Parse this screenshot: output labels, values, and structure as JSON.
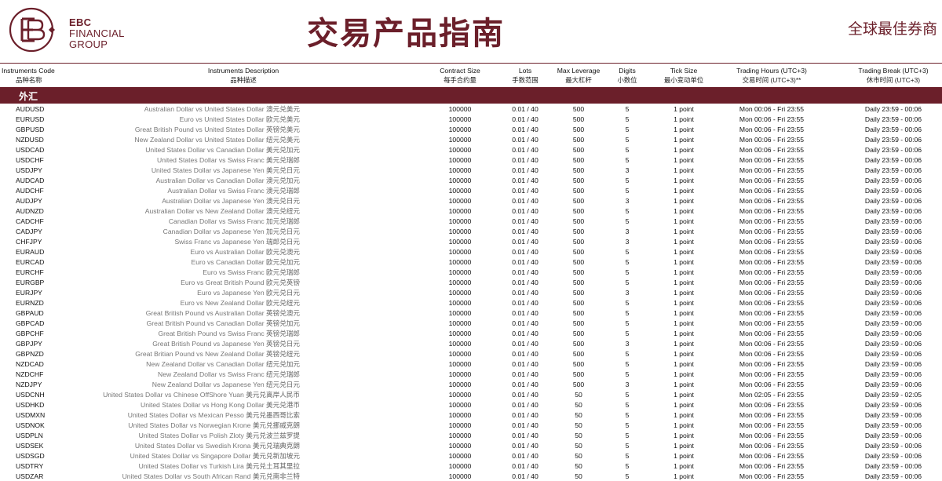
{
  "header": {
    "logo": {
      "line1": "EBC",
      "line2": "FINANCIAL",
      "line3": "GROUP"
    },
    "title": "交易产品指南",
    "slogan": "全球最佳券商"
  },
  "colors": {
    "brand": "#6b1f2a"
  },
  "columns": [
    {
      "en": "Instruments Code",
      "cn": "品种名称"
    },
    {
      "en": "Instruments Description",
      "cn": "品种描述"
    },
    {
      "en": "Contract Size",
      "cn": "每手合约量"
    },
    {
      "en": "Lots",
      "cn": "手数范围"
    },
    {
      "en": "Max Leverage",
      "cn": "最大杠杆"
    },
    {
      "en": "Digits",
      "cn": "小数位"
    },
    {
      "en": "Tick Size",
      "cn": "最小变动单位"
    },
    {
      "en": "Trading Hours (UTC+3)",
      "cn": "交易时间 (UTC+3)**"
    },
    {
      "en": "Trading Break  (UTC+3)",
      "cn": "休市时间 (UTC+3)"
    }
  ],
  "section": {
    "label": "外汇"
  },
  "rows": [
    [
      "AUDUSD",
      "Australian Dollar vs United States Dollar",
      "澳元兑美元",
      "100000",
      "0.01 / 40",
      "500",
      "5",
      "1 point",
      "Mon 00:06 - Fri 23:55",
      "Daily 23:59 - 00:06"
    ],
    [
      "EURUSD",
      "Euro vs United States Dollar",
      "欧元兑美元",
      "100000",
      "0.01 / 40",
      "500",
      "5",
      "1 point",
      "Mon 00:06 - Fri 23:55",
      "Daily 23:59 - 00:06"
    ],
    [
      "GBPUSD",
      "Great British Pound vs United States Dollar",
      "英镑兑美元",
      "100000",
      "0.01 / 40",
      "500",
      "5",
      "1 point",
      "Mon 00:06 - Fri 23:55",
      "Daily 23:59 - 00:06"
    ],
    [
      "NZDUSD",
      "New Zealand Dollar vs United States Dollar",
      "纽元兑美元",
      "100000",
      "0.01 / 40",
      "500",
      "5",
      "1 point",
      "Mon 00:06 - Fri 23:55",
      "Daily 23:59 - 00:06"
    ],
    [
      "USDCAD",
      "United States Dollar vs Canadian Dollar",
      "美元兑加元",
      "100000",
      "0.01 / 40",
      "500",
      "5",
      "1 point",
      "Mon 00:06 - Fri 23:55",
      "Daily 23:59 - 00:06"
    ],
    [
      "USDCHF",
      "United States Dollar vs Swiss Franc",
      "美元兑瑞郎",
      "100000",
      "0.01 / 40",
      "500",
      "5",
      "1 point",
      "Mon 00:06 - Fri 23:55",
      "Daily 23:59 - 00:06"
    ],
    [
      "USDJPY",
      "United States Dollar vs Japanese Yen",
      "美元兑日元",
      "100000",
      "0.01 / 40",
      "500",
      "3",
      "1 point",
      "Mon 00:06 - Fri 23:55",
      "Daily 23:59 - 00:06"
    ],
    [
      "AUDCAD",
      "Australian Dollar vs Canadian Dollar",
      "澳元兑加元",
      "100000",
      "0.01 / 40",
      "500",
      "5",
      "1 point",
      "Mon 00:06 - Fri 23:55",
      "Daily 23:59 - 00:06"
    ],
    [
      "AUDCHF",
      "Australian Dollar vs Swiss Franc",
      "澳元兑瑞郎",
      "100000",
      "0.01 / 40",
      "500",
      "5",
      "1 point",
      "Mon 00:06 - Fri 23:55",
      "Daily 23:59 - 00:06"
    ],
    [
      "AUDJPY",
      "Australian Dollar vs Japanese Yen",
      "澳元兑日元",
      "100000",
      "0.01 / 40",
      "500",
      "3",
      "1 point",
      "Mon 00:06 - Fri 23:55",
      "Daily 23:59 - 00:06"
    ],
    [
      "AUDNZD",
      "Australian Dollar vs New Zealand Dollar",
      "澳元兑纽元",
      "100000",
      "0.01 / 40",
      "500",
      "5",
      "1 point",
      "Mon 00:06 - Fri 23:55",
      "Daily 23:59 - 00:06"
    ],
    [
      "CADCHF",
      "Canadian Dollar vs Swiss Franc",
      "加元兑瑞郎",
      "100000",
      "0.01 / 40",
      "500",
      "5",
      "1 point",
      "Mon 00:06 - Fri 23:55",
      "Daily 23:59 - 00:06"
    ],
    [
      "CADJPY",
      "Canadian Dollar vs Japanese Yen",
      "加元兑日元",
      "100000",
      "0.01 / 40",
      "500",
      "3",
      "1 point",
      "Mon 00:06 - Fri 23:55",
      "Daily 23:59 - 00:06"
    ],
    [
      "CHFJPY",
      "Swiss Franc vs Japanese Yen",
      "瑞郎兑日元",
      "100000",
      "0.01 / 40",
      "500",
      "3",
      "1 point",
      "Mon 00:06 - Fri 23:55",
      "Daily 23:59 - 00:06"
    ],
    [
      "EURAUD",
      "Euro vs Australian Dollar",
      "欧元兑澳元",
      "100000",
      "0.01 / 40",
      "500",
      "5",
      "1 point",
      "Mon 00:06 - Fri 23:55",
      "Daily 23:59 - 00:06"
    ],
    [
      "EURCAD",
      "Euro vs Canadian Dollar",
      "欧元兑加元",
      "100000",
      "0.01 / 40",
      "500",
      "5",
      "1 point",
      "Mon 00:06 - Fri 23:55",
      "Daily 23:59 - 00:06"
    ],
    [
      "EURCHF",
      "Euro vs Swiss Franc",
      "欧元兑瑞郎",
      "100000",
      "0.01 / 40",
      "500",
      "5",
      "1 point",
      "Mon 00:06 - Fri 23:55",
      "Daily 23:59 - 00:06"
    ],
    [
      "EURGBP",
      "Euro vs Great British Pound",
      "欧元兑英镑",
      "100000",
      "0.01 / 40",
      "500",
      "5",
      "1 point",
      "Mon 00:06 - Fri 23:55",
      "Daily 23:59 - 00:06"
    ],
    [
      "EURJPY",
      "Euro vs Japanese Yen",
      "欧元兑日元",
      "100000",
      "0.01 / 40",
      "500",
      "3",
      "1 point",
      "Mon 00:06 - Fri 23:55",
      "Daily 23:59 - 00:06"
    ],
    [
      "EURNZD",
      "Euro vs New Zealand Dollar",
      "欧元兑纽元",
      "100000",
      "0.01 / 40",
      "500",
      "5",
      "1 point",
      "Mon 00:06 - Fri 23:55",
      "Daily 23:59 - 00:06"
    ],
    [
      "GBPAUD",
      "Great British Pound vs Australian Dollar",
      "英镑兑澳元",
      "100000",
      "0.01 / 40",
      "500",
      "5",
      "1 point",
      "Mon 00:06 - Fri 23:55",
      "Daily 23:59 - 00:06"
    ],
    [
      "GBPCAD",
      "Great British Pound vs Canadian Dollar",
      "英镑兑加元",
      "100000",
      "0.01 / 40",
      "500",
      "5",
      "1 point",
      "Mon 00:06 - Fri 23:55",
      "Daily 23:59 - 00:06"
    ],
    [
      "GBPCHF",
      "Great British Pound vs Swiss Franc",
      "英镑兑瑞郎",
      "100000",
      "0.01 / 40",
      "500",
      "5",
      "1 point",
      "Mon 00:06 - Fri 23:55",
      "Daily 23:59 - 00:06"
    ],
    [
      "GBPJPY",
      "Great British Pound vs Japanese Yen",
      "英镑兑日元",
      "100000",
      "0.01 / 40",
      "500",
      "3",
      "1 point",
      "Mon 00:06 - Fri 23:55",
      "Daily 23:59 - 00:06"
    ],
    [
      "GBPNZD",
      "Great Britian Pound vs New Zealand Dollar",
      "英镑兑纽元",
      "100000",
      "0.01 / 40",
      "500",
      "5",
      "1 point",
      "Mon 00:06 - Fri 23:55",
      "Daily 23:59 - 00:06"
    ],
    [
      "NZDCAD",
      "New Zealand Dollar vs Canadian Dollar",
      "纽元兑加元",
      "100000",
      "0.01 / 40",
      "500",
      "5",
      "1 point",
      "Mon 00:06 - Fri 23:55",
      "Daily 23:59 - 00:06"
    ],
    [
      "NZDCHF",
      "New Zealand Dollar vs Swiss Franc",
      "纽元兑瑞郎",
      "100000",
      "0.01 / 40",
      "500",
      "5",
      "1 point",
      "Mon 00:06 - Fri 23:55",
      "Daily 23:59 - 00:06"
    ],
    [
      "NZDJPY",
      "New Zealand Dollar vs Japanese Yen",
      "纽元兑日元",
      "100000",
      "0.01 / 40",
      "500",
      "3",
      "1 point",
      "Mon 00:06 - Fri 23:55",
      "Daily 23:59 - 00:06"
    ],
    [
      "USDCNH",
      "United States Dollar vs Chinese OffShore Yuan",
      "美元兑离岸人民币",
      "100000",
      "0.01 / 40",
      "50",
      "5",
      "1 point",
      "Mon 02:05 - Fri 23:55",
      "Daily 23:59 - 02:05"
    ],
    [
      "USDHKD",
      "United States Dollar vs Hong Kong Dollar",
      "美元兑港币",
      "100000",
      "0.01 / 40",
      "50",
      "5",
      "1 point",
      "Mon 00:06 - Fri 23:55",
      "Daily 23:59 - 00:06"
    ],
    [
      "USDMXN",
      "United States Dollar vs Mexican Pesso",
      "美元兑墨西哥比索",
      "100000",
      "0.01 / 40",
      "50",
      "5",
      "1 point",
      "Mon 00:06 - Fri 23:55",
      "Daily 23:59 - 00:06"
    ],
    [
      "USDNOK",
      "United States Dollar vs Norwegian Krone",
      "美元兑挪威克朗",
      "100000",
      "0.01 / 40",
      "50",
      "5",
      "1 point",
      "Mon 00:06 - Fri 23:55",
      "Daily 23:59 - 00:06"
    ],
    [
      "USDPLN",
      "United States Dollar vs Polish Zloty",
      "美元兑波兰兹罗提",
      "100000",
      "0.01 / 40",
      "50",
      "5",
      "1 point",
      "Mon 00:06 - Fri 23:55",
      "Daily 23:59 - 00:06"
    ],
    [
      "USDSEK",
      "United States Dollar vs Swedish Krona",
      "美元兑瑞典克朗",
      "100000",
      "0.01 / 40",
      "50",
      "5",
      "1 point",
      "Mon 00:06 - Fri 23:55",
      "Daily 23:59 - 00:06"
    ],
    [
      "USDSGD",
      "United States Dollar vs Singapore Dollar",
      "美元兑新加坡元",
      "100000",
      "0.01 / 40",
      "50",
      "5",
      "1 point",
      "Mon 00:06 - Fri 23:55",
      "Daily 23:59 - 00:06"
    ],
    [
      "USDTRY",
      "United States Dollar vs Turkish Lira",
      "美元兑土耳其里拉",
      "100000",
      "0.01 / 40",
      "50",
      "5",
      "1 point",
      "Mon 00:06 - Fri 23:55",
      "Daily 23:59 - 00:06"
    ],
    [
      "USDZAR",
      "United States Dollar vs South African Rand",
      "美元兑南非兰特",
      "100000",
      "0.01 / 40",
      "50",
      "5",
      "1 point",
      "Mon 00:06 - Fri 23:55",
      "Daily 23:59 - 00:06"
    ]
  ]
}
